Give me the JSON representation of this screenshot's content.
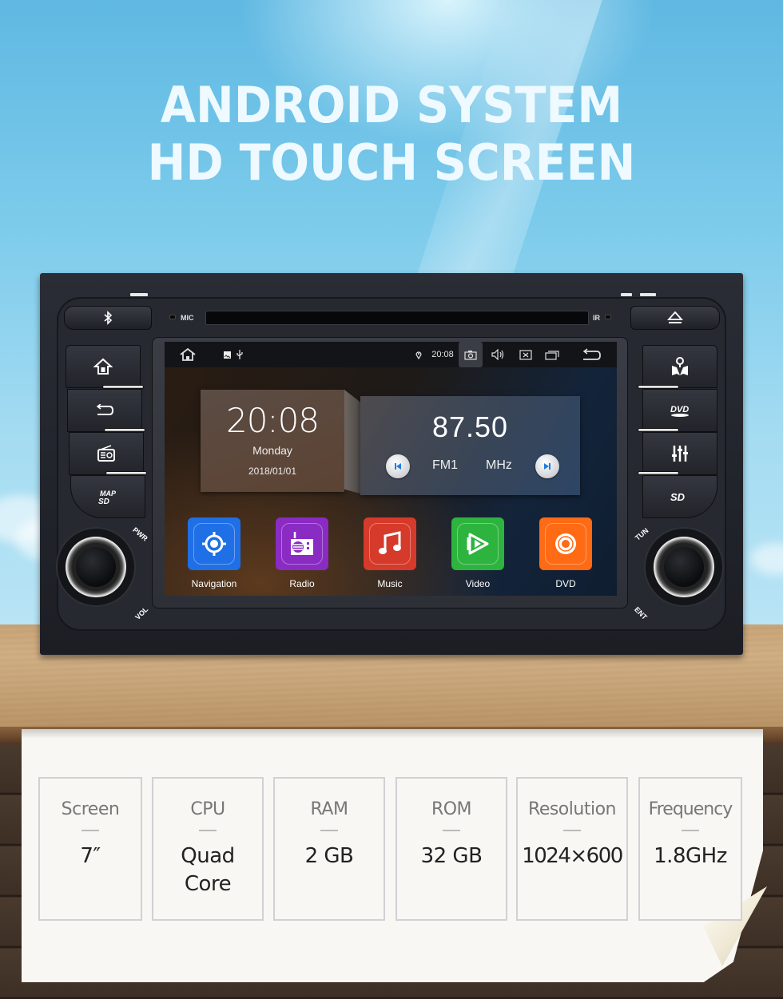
{
  "headline": {
    "line1": "ANDROID SYSTEM",
    "line2": "HD TOUCH SCREEN"
  },
  "head_unit": {
    "labels": {
      "mic": "MIC",
      "ir": "IR",
      "pwr": "PWR",
      "vol": "VOL",
      "tun": "TUN",
      "ent": "ENT"
    },
    "left_buttons": [
      {
        "name": "bluetooth",
        "icon": "bluetooth-icon"
      },
      {
        "name": "home",
        "icon": "home-icon"
      },
      {
        "name": "back",
        "icon": "back-icon"
      },
      {
        "name": "radio",
        "icon": "radio-icon"
      },
      {
        "name": "map-sd",
        "icon": "map-sd-icon",
        "text": "MAP SD"
      }
    ],
    "right_buttons": [
      {
        "name": "eject",
        "icon": "eject-icon"
      },
      {
        "name": "navigation",
        "icon": "map-pin-icon"
      },
      {
        "name": "dvd",
        "icon": "dvd-icon",
        "text": "DVD"
      },
      {
        "name": "equalizer",
        "icon": "equalizer-icon"
      },
      {
        "name": "sd",
        "icon": "sd-icon",
        "text": "SD"
      }
    ]
  },
  "screen": {
    "statusbar": {
      "time": "20:08",
      "icons": [
        "home-icon",
        "image-icon",
        "usb-icon",
        "location-icon",
        "camera-icon",
        "volume-icon",
        "close-box-icon",
        "recent-apps-icon",
        "back-icon"
      ]
    },
    "clock_widget": {
      "time": "20:08",
      "day": "Monday",
      "date": "2018/01/01"
    },
    "radio_widget": {
      "frequency": "87.50",
      "band": "FM1",
      "unit": "MHz"
    },
    "apps": [
      {
        "label": "Navigation",
        "color": "#1f6fe6",
        "icon": "navigation-target-icon"
      },
      {
        "label": "Radio",
        "color": "#8a2bc4",
        "icon": "radio-icon"
      },
      {
        "label": "Music",
        "color": "#d63a2a",
        "icon": "music-note-icon"
      },
      {
        "label": "Video",
        "color": "#2db43e",
        "icon": "video-play-icon"
      },
      {
        "label": "DVD",
        "color": "#ff6a14",
        "icon": "disc-icon"
      }
    ]
  },
  "specs": [
    {
      "label": "Screen",
      "value": "7″"
    },
    {
      "label": "CPU",
      "value": "Quad Core"
    },
    {
      "label": "RAM",
      "value": "2 GB"
    },
    {
      "label": "ROM",
      "value": "32 GB"
    },
    {
      "label": "Resolution",
      "value": "1024×600"
    },
    {
      "label": "Frequency",
      "value": "1.8GHz"
    }
  ]
}
